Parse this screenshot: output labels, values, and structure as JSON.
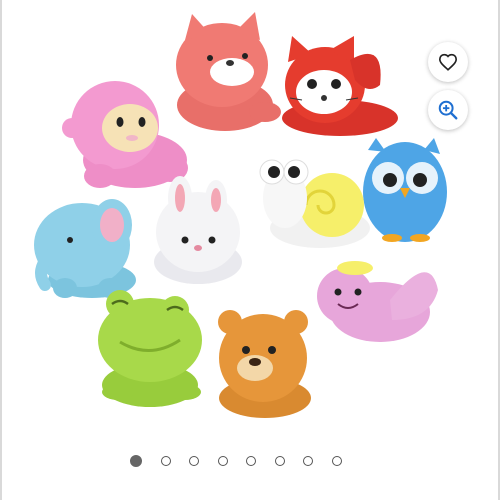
{
  "product_gallery": {
    "image_count": 8,
    "active_index": 0,
    "toys": [
      {
        "name": "fox-toy",
        "color": "#f07a73"
      },
      {
        "name": "red-fox-toy",
        "color": "#e53c2e"
      },
      {
        "name": "monkey-toy",
        "color": "#f39ad0"
      },
      {
        "name": "rabbit-toy",
        "color": "#f4f4f6"
      },
      {
        "name": "snail-toy",
        "color": "#f6ef6a"
      },
      {
        "name": "owl-toy",
        "color": "#4ea5e6"
      },
      {
        "name": "elephant-toy",
        "color": "#8fd0e8"
      },
      {
        "name": "bird-toy",
        "color": "#e7a6da"
      },
      {
        "name": "frog-toy",
        "color": "#a8d94a"
      },
      {
        "name": "bear-toy",
        "color": "#e6963a"
      }
    ]
  },
  "actions": {
    "wishlist_icon": "heart-icon",
    "zoom_icon": "zoom-in-icon",
    "accent_color": "#1f6fd1"
  }
}
